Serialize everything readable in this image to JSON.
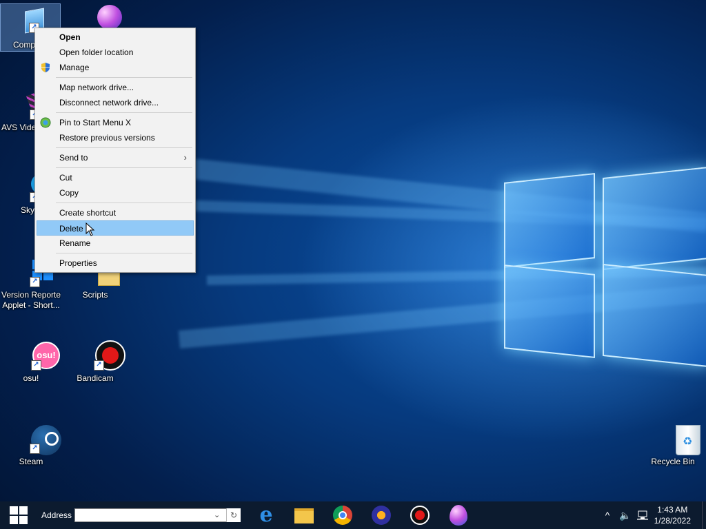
{
  "desktop": {
    "icons": [
      {
        "label": "Comp",
        "selected": true
      },
      {
        "label": ""
      },
      {
        "label": "AVS Vide"
      },
      {
        "label": "Sky"
      },
      {
        "label": "Version Reporter"
      },
      {
        "label": "Applet - Short..."
      },
      {
        "label": "Scripts"
      },
      {
        "label": "osu!"
      },
      {
        "label": "Bandicam"
      },
      {
        "label": "Steam"
      },
      {
        "label": "Recycle Bin"
      }
    ],
    "badges": {
      "osu": "osu!"
    }
  },
  "context_menu": {
    "items": [
      {
        "label": "Open",
        "bold": true
      },
      {
        "label": "Open folder location"
      },
      {
        "label": "Manage",
        "icon": "shield-icon"
      },
      {
        "label": "Map network drive..."
      },
      {
        "label": "Disconnect network drive..."
      },
      {
        "label": "Pin to Start Menu X",
        "icon": "pin-icon"
      },
      {
        "label": "Restore previous versions"
      },
      {
        "label": "Send to",
        "submenu": true
      },
      {
        "label": "Cut"
      },
      {
        "label": "Copy"
      },
      {
        "label": "Create shortcut"
      },
      {
        "label": "Delete",
        "highlighted": true
      },
      {
        "label": "Rename"
      },
      {
        "label": "Properties"
      }
    ]
  },
  "taskbar": {
    "address_label": "Address",
    "address_value": "",
    "apps": [
      "edge-icon",
      "file-explorer-icon",
      "chrome-icon",
      "app-icon",
      "bandicam-icon",
      "paint-icon"
    ],
    "clock_time": "1:43 AM",
    "clock_date": "1/28/2022"
  },
  "colors": {
    "highlight": "#91c9f7",
    "taskbar": "#0c1b2f"
  }
}
